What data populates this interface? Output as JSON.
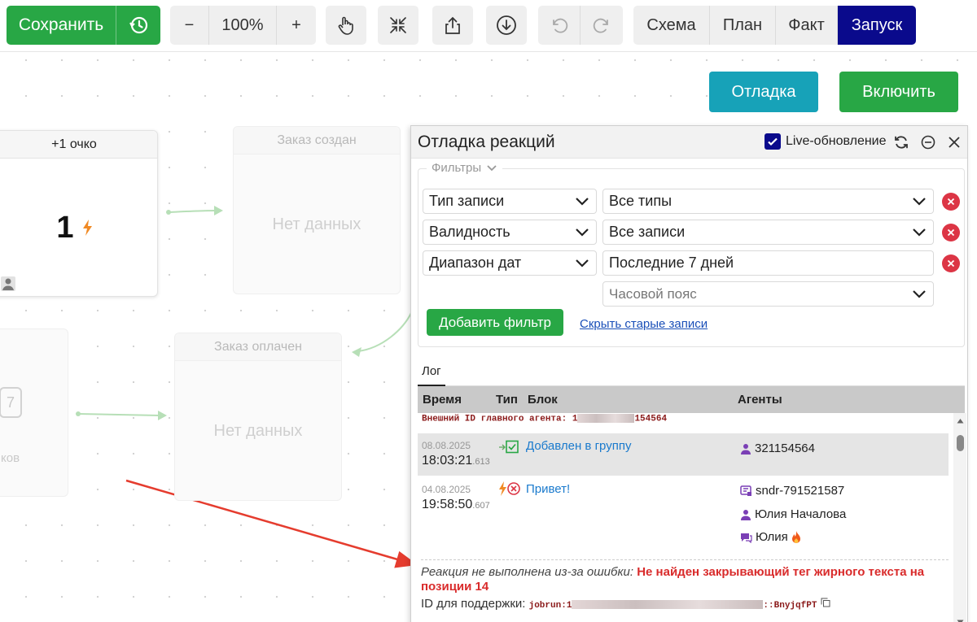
{
  "toolbar": {
    "save_label": "Сохранить",
    "zoom_out": "−",
    "zoom_value": "100%",
    "zoom_in": "+",
    "views": [
      "Схема",
      "План",
      "Факт",
      "Запуск"
    ],
    "active_view": "Запуск"
  },
  "canvas": {
    "debug_label": "Отладка",
    "enable_label": "Включить",
    "score_node": {
      "header": "+1 очко",
      "value": "1"
    },
    "node_created": {
      "header": "Заказ создан",
      "body": "Нет данных"
    },
    "node_paid": {
      "header": "Заказ оплачен",
      "body": "Нет данных"
    },
    "left_node": {
      "badge": "7",
      "text": "ков"
    }
  },
  "panel": {
    "title": "Отладка реакций",
    "live_label": "Live-обновление",
    "filters_legend": "Фильтры",
    "filters": [
      {
        "field": "Тип записи",
        "value": "Все типы"
      },
      {
        "field": "Валидность",
        "value": "Все записи"
      },
      {
        "field": "Диапазон дат",
        "value": "Последние 7 дней"
      }
    ],
    "timezone_placeholder": "Часовой пояс",
    "add_filter_label": "Добавить фильтр",
    "hide_old_label": "Скрыть старые записи",
    "tab_log": "Лог",
    "columns": {
      "time": "Время",
      "type": "Тип",
      "block": "Блок",
      "agents": "Агенты"
    },
    "ext_id_label": "Внешний ID главного агента: 1",
    "ext_id_tail": "154564",
    "rows": [
      {
        "date": "08.08.2025",
        "time": "18:03:21",
        "ms": ".613",
        "block": "Добавлен в группу",
        "agents": [
          "321154564"
        ]
      },
      {
        "date": "04.08.2025",
        "time": "19:58:50",
        "ms": ".607",
        "block": "Привет!",
        "agents": [
          "sndr-791521587",
          "Юлия Началова",
          "Юлия"
        ]
      }
    ],
    "error_prefix": "Реакция не выполнена из-за ошибки:",
    "error_text": "Не найден закрывающий тег жирного текста на позиции 14",
    "support_label": "ID для поддержки:",
    "support_id_head": "jobrun:1",
    "support_id_tail": "::BnyjqfPT"
  }
}
